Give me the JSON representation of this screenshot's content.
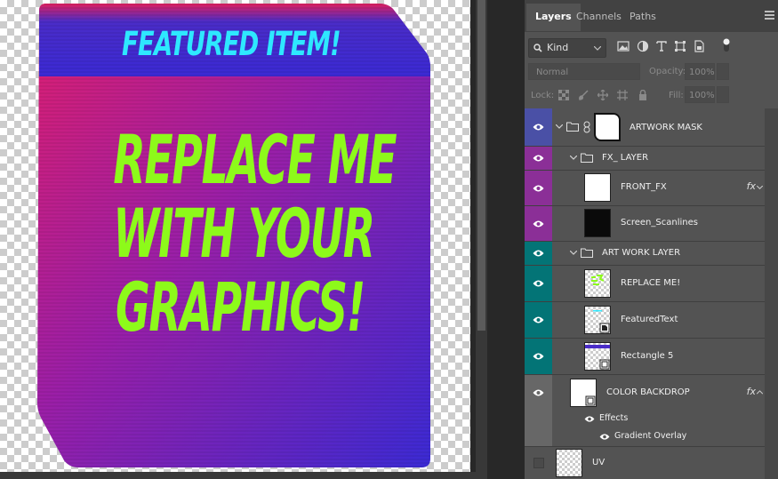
{
  "canvas": {
    "featured_text": "FEATURED ITEM!",
    "main_lines": [
      "REPLACE ME",
      "WITH YOUR",
      "GRAPHICS!"
    ]
  },
  "tabs": [
    {
      "label": "Layers",
      "active": true
    },
    {
      "label": "Channels",
      "active": false
    },
    {
      "label": "Paths",
      "active": false
    }
  ],
  "filter": {
    "kind_label": "Kind"
  },
  "blend": {
    "mode": "Normal",
    "opacity_label": "Opacity:",
    "opacity_value": "100%"
  },
  "lock": {
    "label": "Lock:",
    "fill_label": "Fill:",
    "fill_value": "100%"
  },
  "layers": [
    {
      "name": "ARTWORK MASK",
      "type": "group",
      "color": "#4a50a6"
    },
    {
      "name": "FX_ LAYER",
      "type": "group",
      "color": "#8b2f97"
    },
    {
      "name": "FRONT_FX",
      "type": "layer",
      "color": "#8b2f97",
      "fx": "fx"
    },
    {
      "name": "Screen_Scanlines",
      "type": "layer",
      "color": "#8b2f97"
    },
    {
      "name": "ART WORK LAYER",
      "type": "group",
      "color": "#037476"
    },
    {
      "name": "REPLACE ME!",
      "type": "layer",
      "color": "#037476"
    },
    {
      "name": "FeaturedText",
      "type": "layer",
      "color": "#037476"
    },
    {
      "name": "Rectangle 5",
      "type": "layer",
      "color": "#037476"
    },
    {
      "name": "COLOR BACKDROP",
      "type": "layer",
      "color": "#676767",
      "fx": "fx"
    },
    {
      "name": "Effects",
      "type": "effects"
    },
    {
      "name": "Gradient Overlay",
      "type": "effect"
    },
    {
      "name": "UV",
      "type": "layer",
      "color": "#535353"
    }
  ],
  "colors": {
    "art_magenta": "#e01f6e",
    "art_blue": "#3f2ac8",
    "featured_text": "#2ee8ff",
    "main_text": "#8dfa1a",
    "selected_tab_bg": "#535353"
  }
}
